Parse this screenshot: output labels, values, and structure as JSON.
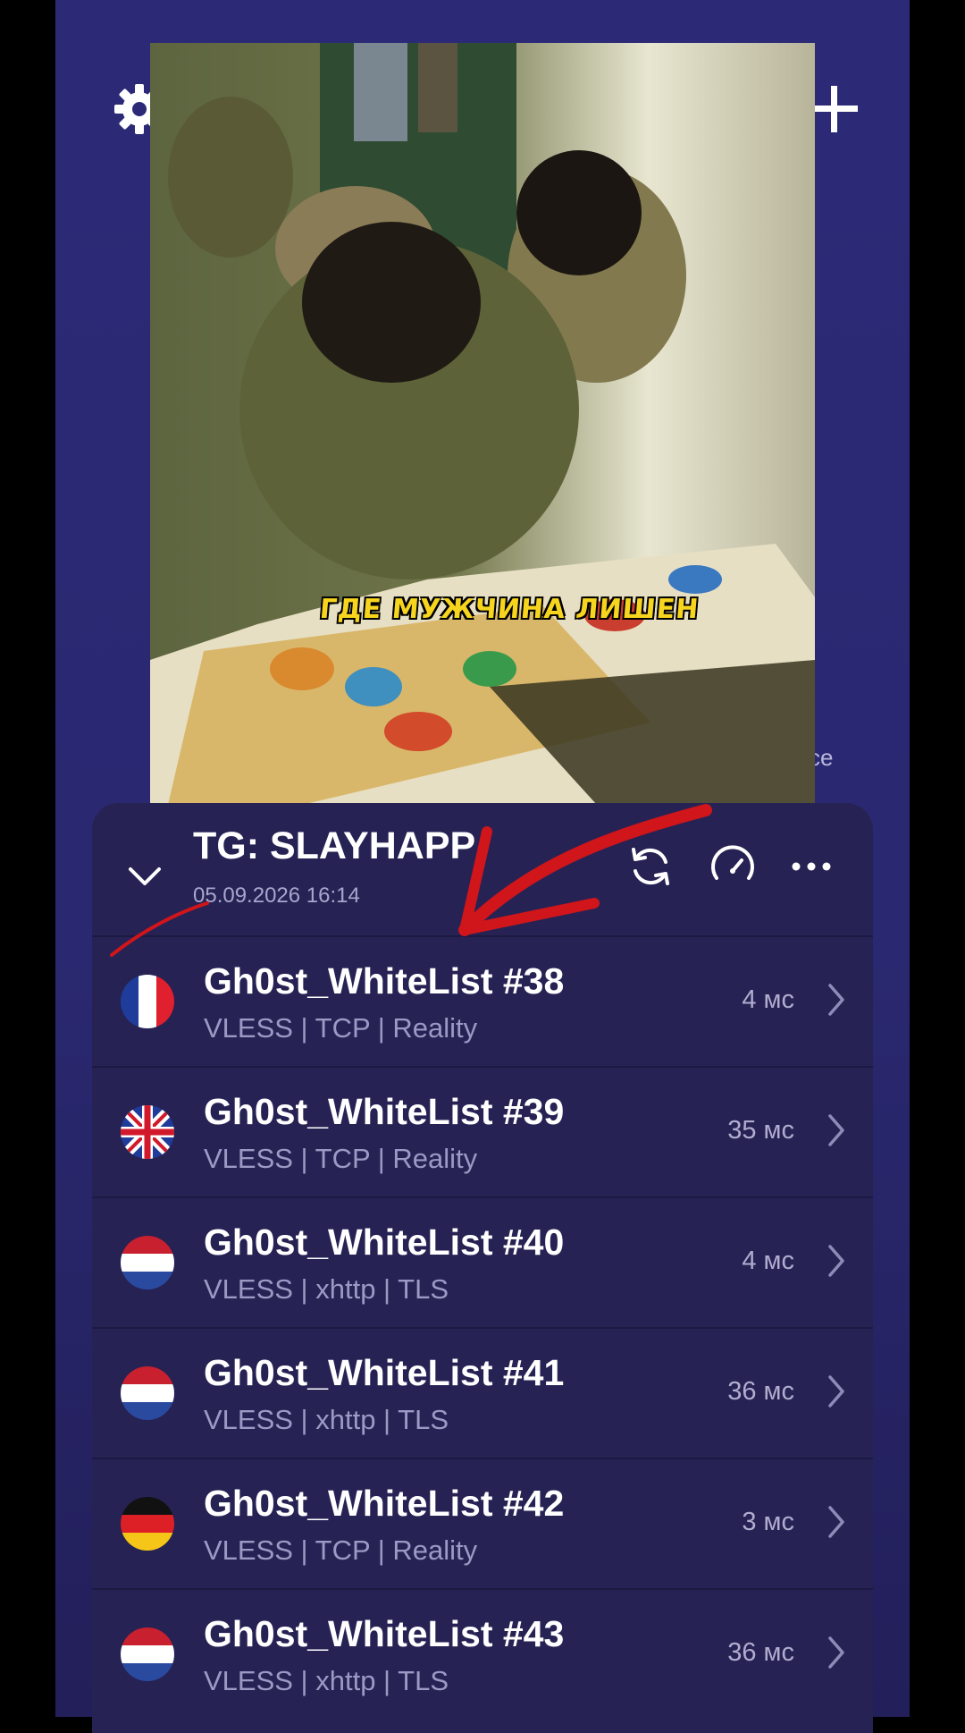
{
  "header": {
    "settings_icon": "gear-icon",
    "add_icon": "plus-icon",
    "side_text": "ce"
  },
  "video": {
    "caption": "ГДЕ МУЖЧИНА ЛИШЕН"
  },
  "group": {
    "title": "TG: SLAYHAPP",
    "date": "05.09.2026 16:14",
    "icons": [
      "chevron-down-icon",
      "refresh-icon",
      "speedometer-icon",
      "more-icon"
    ]
  },
  "servers": [
    {
      "name": "Gh0st_WhiteList #38",
      "protocol": "VLESS | TCP | Reality",
      "ping": "4 мс",
      "country": "France"
    },
    {
      "name": "Gh0st_WhiteList #39",
      "protocol": "VLESS | TCP | Reality",
      "ping": "35 мс",
      "country": "United Kingdom"
    },
    {
      "name": "Gh0st_WhiteList #40",
      "protocol": "VLESS | xhttp | TLS",
      "ping": "4 мс",
      "country": "Netherlands"
    },
    {
      "name": "Gh0st_WhiteList #41",
      "protocol": "VLESS | xhttp | TLS",
      "ping": "36 мс",
      "country": "Netherlands"
    },
    {
      "name": "Gh0st_WhiteList #42",
      "protocol": "VLESS | TCP | Reality",
      "ping": "3 мс",
      "country": "Germany"
    },
    {
      "name": "Gh0st_WhiteList #43",
      "protocol": "VLESS | xhttp | TLS",
      "ping": "36 мс",
      "country": "Netherlands"
    }
  ],
  "colors": {
    "background": "#2a2870",
    "panel": "#262254",
    "annotation": "#d0151b"
  }
}
